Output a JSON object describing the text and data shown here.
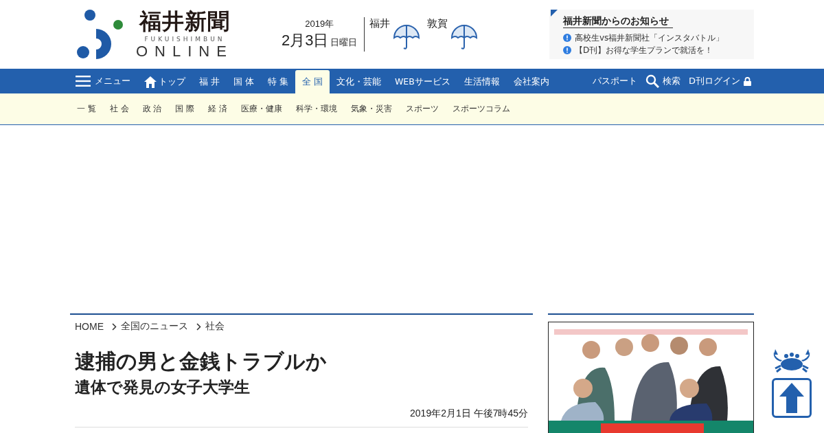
{
  "logo": {
    "title": "福井新聞",
    "romaji": "FUKUISHIMBUN",
    "online": "ONLINE"
  },
  "date": {
    "year": "2019年",
    "day": "2月3日",
    "weekday": "日曜日"
  },
  "weather": [
    {
      "city": "福井",
      "kind": "rain"
    },
    {
      "city": "敦賀",
      "kind": "rain"
    }
  ],
  "notice": {
    "title": "福井新聞からのお知らせ",
    "items": [
      "高校生vs福井新聞社「インスタバトル」",
      "【D刊】お得な学生プランで就活を！"
    ]
  },
  "nav": {
    "menu": "メニュー",
    "items": [
      {
        "label": "トップ",
        "kind": "home",
        "selected": false
      },
      {
        "label": "福 井",
        "kind": "text",
        "selected": false
      },
      {
        "label": "国 体",
        "kind": "text",
        "selected": false
      },
      {
        "label": "特 集",
        "kind": "text",
        "selected": false
      },
      {
        "label": "全 国",
        "kind": "text",
        "selected": true
      },
      {
        "label": "文化・芸能",
        "kind": "text",
        "selected": false
      },
      {
        "label": "WEBサービス",
        "kind": "text",
        "selected": false
      },
      {
        "label": "生活情報",
        "kind": "text",
        "selected": false
      },
      {
        "label": "会社案内",
        "kind": "text",
        "selected": false
      }
    ],
    "right": [
      {
        "label": "パスポート",
        "kind": "text"
      },
      {
        "label": "検索",
        "kind": "search"
      },
      {
        "label": "D刊ログイン",
        "kind": "lock"
      }
    ]
  },
  "subnav": [
    "一 覧",
    "社 会",
    "政 治",
    "国 際",
    "経 済",
    "医療・健康",
    "科学・環境",
    "気象・災害",
    "スポーツ",
    "スポーツコラム"
  ],
  "breadcrumb": [
    "HOME",
    "全国のニュース",
    "社会"
  ],
  "article": {
    "headline": "逮捕の男と金銭トラブルか",
    "subhead": "遺体で発見の女子大学生",
    "timestamp": "2019年2月1日 午後7時45分"
  }
}
